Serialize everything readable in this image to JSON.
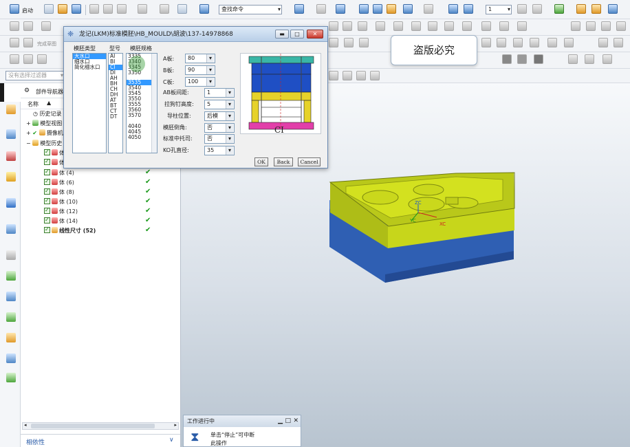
{
  "toolbar": {
    "start_label": "启动",
    "search_command": "查找命令",
    "layer_value": "1",
    "row2_hint": "完成草图",
    "filter_placeholder": "没有选择过滤器"
  },
  "navigator": {
    "title": "部件导航器",
    "col_name": "名称",
    "items": [
      {
        "label": "历史记录"
      },
      {
        "label": "模型视图"
      },
      {
        "label": "摄像机"
      },
      {
        "label": "模型历史"
      },
      {
        "label": "体"
      },
      {
        "label": "体"
      },
      {
        "label": "体 (4)"
      },
      {
        "label": "体 (6)"
      },
      {
        "label": "体 (8)"
      },
      {
        "label": "体 (10)"
      },
      {
        "label": "体 (12)"
      },
      {
        "label": "体 (14)"
      },
      {
        "label": "线性尺寸 (52)"
      }
    ],
    "dependency_label": "相依性"
  },
  "dialog": {
    "title": "龙记(LKM)标准模胚\\HB_MOULD\\胡波\\137-14978868",
    "col_type": "模胚类型",
    "col_model": "型号",
    "col_spec": "模胚规格",
    "types": [
      "大水口",
      "细水口",
      "简化细水口"
    ],
    "models": [
      "AI",
      "BI",
      "CI",
      "DI",
      "AH",
      "BH",
      "CH",
      "DH",
      "AT",
      "BT",
      "CT",
      "DT"
    ],
    "specs_top": [
      "3335",
      "3340",
      "3345",
      "3350"
    ],
    "specs_bottom": [
      "3535",
      "3540",
      "3545",
      "3550",
      "3555",
      "3560",
      "3570",
      "",
      "4040",
      "4045",
      "4050"
    ],
    "a_plate_label": "A板:",
    "a_plate_value": "80",
    "b_plate_label": "B板:",
    "b_plate_value": "90",
    "c_plate_label": "C板:",
    "c_plate_value": "100",
    "ab_gap_label": "AB板间距:",
    "ab_gap_value": "1",
    "pull_nail_label": "拉狗钉高度:",
    "pull_nail_value": "5",
    "guide_label": "导柱位置:",
    "guide_value": "后模",
    "chamfer_label": "模胚倒角:",
    "chamfer_value": "否",
    "support_label": "标准中托司:",
    "support_value": "否",
    "ko_label": "KO孔直径:",
    "ko_value": "35",
    "preview_caption": "CI",
    "ok": "OK",
    "back": "Back",
    "cancel": "Cancel"
  },
  "watermark": "盗版必究",
  "progress": {
    "title": "工作进行中",
    "line1": "单击“停止”可中断",
    "line2": "此操作"
  },
  "axes": {
    "z": "ZC",
    "y": "YC",
    "x": "XC"
  },
  "colors": {
    "cavity": "#c7d61b",
    "core": "#2f5fb3",
    "dialog_select": "#3399ff"
  }
}
